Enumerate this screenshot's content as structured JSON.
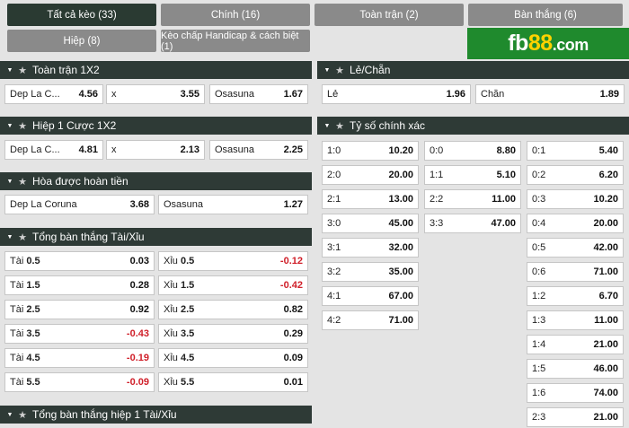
{
  "tabs": {
    "all": "Tất cả kèo (33)",
    "main": "Chính (16)",
    "fulltime": "Toàn trận (2)",
    "goals": "Bàn thắng (6)",
    "half": "Hiệp (8)",
    "handicap": "Kèo chấp Handicap & cách biệt (1)"
  },
  "logo": {
    "text": "fb",
    "num": "88",
    "domain": ".com"
  },
  "sections": {
    "fulltime_1x2": "Toàn trận 1X2",
    "half1_1x2": "Hiệp 1 Cược 1X2",
    "draw_no_bet": "Hòa được hoàn tiền",
    "total_goals": "Tổng bàn thắng Tài/Xỉu",
    "total_goals_h1": "Tổng bàn thắng hiệp 1 Tài/Xỉu",
    "odd_even": "Lẻ/Chẵn",
    "correct_score": "Tỷ số chính xác"
  },
  "fulltime_1x2": [
    {
      "label": "Dep La C...",
      "odd": "4.56"
    },
    {
      "label": "x",
      "odd": "3.55"
    },
    {
      "label": "Osasuna",
      "odd": "1.67"
    }
  ],
  "half1_1x2": [
    {
      "label": "Dep La C...",
      "odd": "4.81"
    },
    {
      "label": "x",
      "odd": "2.13"
    },
    {
      "label": "Osasuna",
      "odd": "2.25"
    }
  ],
  "draw_no_bet": [
    {
      "label": "Dep La Coruna",
      "odd": "3.68"
    },
    {
      "label": "Osasuna",
      "odd": "1.27"
    }
  ],
  "total_goals": {
    "over_word": "Tài",
    "under_word": "Xỉu",
    "rows": [
      {
        "line": "0.5",
        "over": "0.03",
        "under": "-0.12"
      },
      {
        "line": "1.5",
        "over": "0.28",
        "under": "-0.42"
      },
      {
        "line": "2.5",
        "over": "0.92",
        "under": "0.82"
      },
      {
        "line": "3.5",
        "over": "-0.43",
        "under": "0.29"
      },
      {
        "line": "4.5",
        "over": "-0.19",
        "under": "0.09"
      },
      {
        "line": "5.5",
        "over": "-0.09",
        "under": "0.01"
      }
    ]
  },
  "odd_even": [
    {
      "label": "Lẻ",
      "odd": "1.96"
    },
    {
      "label": "Chẵn",
      "odd": "1.89"
    }
  ],
  "correct_score": {
    "home": [
      {
        "score": "1:0",
        "odd": "10.20"
      },
      {
        "score": "2:0",
        "odd": "20.00"
      },
      {
        "score": "2:1",
        "odd": "13.00"
      },
      {
        "score": "3:0",
        "odd": "45.00"
      },
      {
        "score": "3:1",
        "odd": "32.00"
      },
      {
        "score": "3:2",
        "odd": "35.00"
      },
      {
        "score": "4:1",
        "odd": "67.00"
      },
      {
        "score": "4:2",
        "odd": "71.00"
      }
    ],
    "draw": [
      {
        "score": "0:0",
        "odd": "8.80"
      },
      {
        "score": "1:1",
        "odd": "5.10"
      },
      {
        "score": "2:2",
        "odd": "11.00"
      },
      {
        "score": "3:3",
        "odd": "47.00"
      }
    ],
    "away": [
      {
        "score": "0:1",
        "odd": "5.40"
      },
      {
        "score": "0:2",
        "odd": "6.20"
      },
      {
        "score": "0:3",
        "odd": "10.20"
      },
      {
        "score": "0:4",
        "odd": "20.00"
      },
      {
        "score": "0:5",
        "odd": "42.00"
      },
      {
        "score": "0:6",
        "odd": "71.00"
      },
      {
        "score": "1:2",
        "odd": "6.70"
      },
      {
        "score": "1:3",
        "odd": "11.00"
      },
      {
        "score": "1:4",
        "odd": "21.00"
      },
      {
        "score": "1:5",
        "odd": "46.00"
      },
      {
        "score": "1:6",
        "odd": "74.00"
      },
      {
        "score": "2:3",
        "odd": "21.00"
      }
    ]
  },
  "colors": {
    "active_tab": "#2a3a32",
    "tab": "#8a8a8a",
    "section": "#2e3a36",
    "negative": "#d0202a",
    "logo_bg": "#1f8a2d",
    "logo_accent": "#ffd200"
  }
}
